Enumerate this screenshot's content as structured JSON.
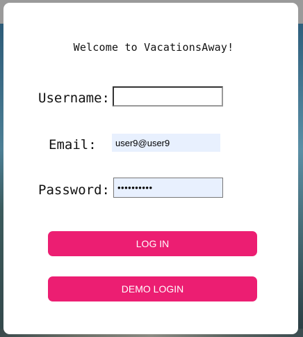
{
  "modal": {
    "welcome_text": "Welcome to VacationsAway!",
    "fields": {
      "username": {
        "label": "Username:",
        "value": ""
      },
      "email": {
        "label": "Email:",
        "value": "user9@user9"
      },
      "password": {
        "label": "Password:",
        "value": "••••••••••"
      }
    },
    "buttons": {
      "login_label": "LOG IN",
      "demo_login_label": "DEMO LOGIN"
    }
  },
  "colors": {
    "button_bg": "#ec1e72",
    "button_text": "#ffffff",
    "autofill_bg": "#e8f0fe",
    "modal_bg": "#ffffff"
  }
}
